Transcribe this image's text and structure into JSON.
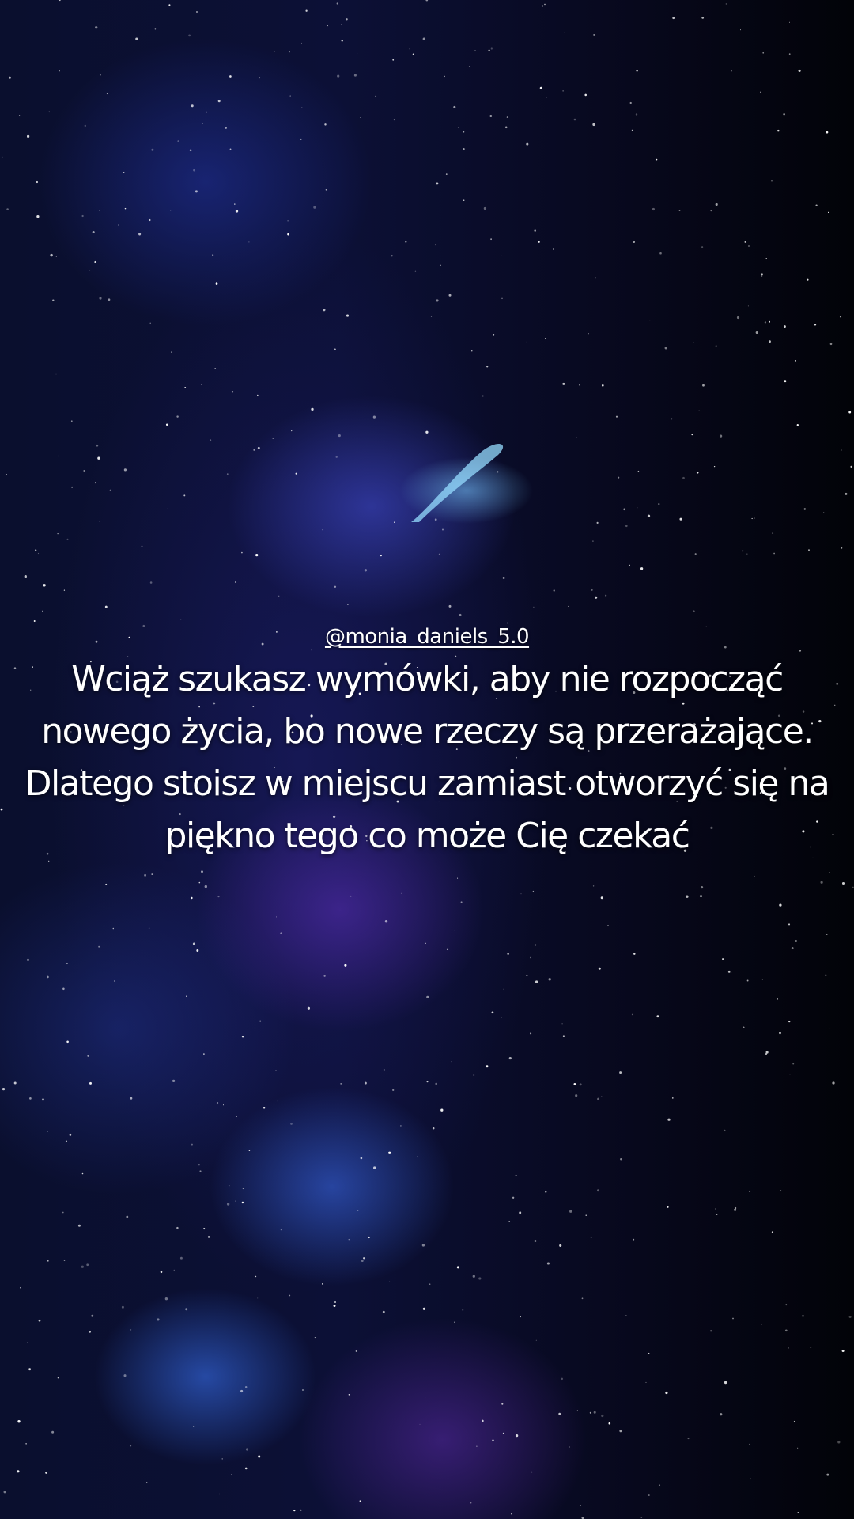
{
  "story": {
    "username": "@monia_daniels_5.0",
    "quote_lines": [
      "Wciąż szukasz wymówki, aby nie rozpocząć",
      "nowego życia, bo nowe rzeczy są przerażające.",
      "Dlatego stoisz w miejscu zamiast otworzyć się na",
      "piękno tego co może Cię czekać"
    ]
  },
  "colors": {
    "text": "#ffffff",
    "background": "#03040c"
  }
}
